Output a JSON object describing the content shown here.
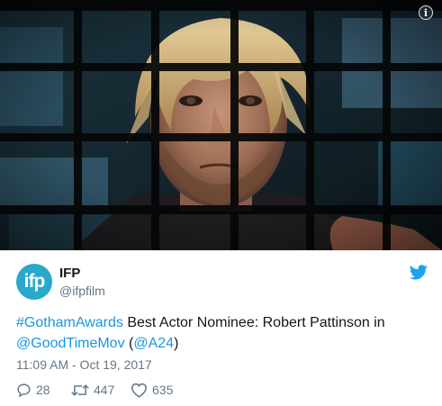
{
  "account": {
    "avatar_text": "ifp",
    "name": "IFP",
    "handle": "@ifpfilm"
  },
  "tweet": {
    "hashtag": "#GothamAwards",
    "text_main": " Best Actor Nominee: Robert Pattinson in ",
    "mention_movie": "@GoodTimeMov",
    "paren_open": " (",
    "mention_studio": "@A24",
    "paren_close": ")",
    "timestamp": "11:09 AM - Oct 19, 2017"
  },
  "media": {
    "info_label": "i"
  },
  "actions": {
    "replies": "28",
    "retweets": "447",
    "likes": "635"
  },
  "colors": {
    "link": "#1b95e0",
    "muted": "#657786",
    "avatar_bg": "#2aa8c9",
    "twitter_blue": "#1da1f2"
  },
  "icons": [
    "info-icon",
    "twitter-bird-icon",
    "reply-icon",
    "retweet-icon",
    "like-icon"
  ]
}
